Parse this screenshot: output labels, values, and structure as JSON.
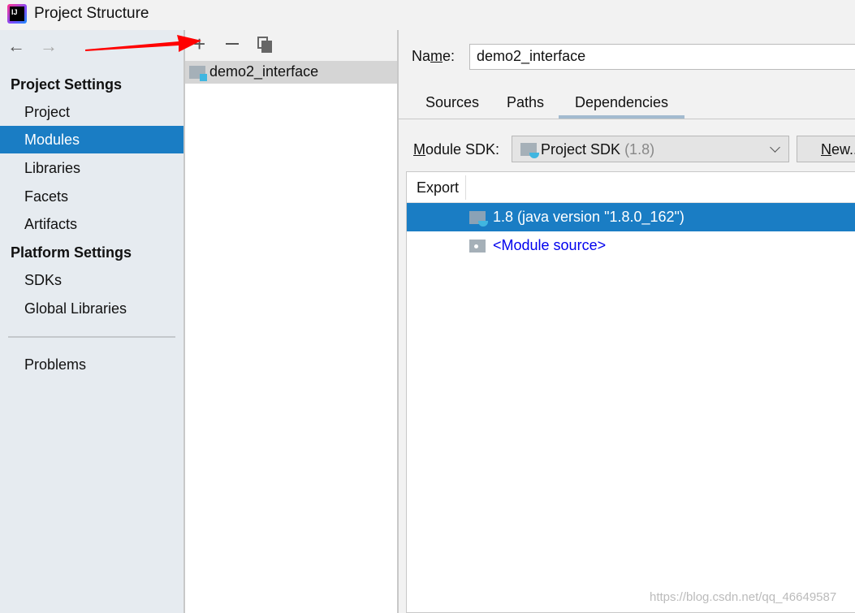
{
  "window": {
    "title": "Project Structure",
    "icon": "intellij-idea-icon"
  },
  "sidebar": {
    "sections": [
      {
        "label": "Project Settings",
        "items": [
          "Project",
          "Modules",
          "Libraries",
          "Facets",
          "Artifacts"
        ]
      },
      {
        "label": "Platform Settings",
        "items": [
          "SDKs",
          "Global Libraries"
        ]
      }
    ],
    "problems": "Problems",
    "selected": "Modules"
  },
  "toolbar": {
    "back": "back-arrow-icon",
    "forward": "forward-arrow-icon",
    "add": "plus-icon",
    "remove": "minus-icon",
    "copy": "copy-icon"
  },
  "modules": [
    {
      "name": "demo2_interface",
      "selected": true
    }
  ],
  "details": {
    "name_label_pre": "Na",
    "name_label_u": "m",
    "name_label_post": "e:",
    "name_value": "demo2_interface",
    "tabs": [
      "Sources",
      "Paths",
      "Dependencies"
    ],
    "active_tab": "Dependencies",
    "sdk_label_u": "M",
    "sdk_label_rest": "odule SDK:",
    "sdk_value": "Project SDK",
    "sdk_version": "(1.8)",
    "new_u": "N",
    "new_rest": "ew...",
    "table": {
      "header": "Export",
      "rows": [
        {
          "text": "1.8 (java version \"1.8.0_162\")",
          "selected": true
        },
        {
          "text": "<Module source>",
          "selected": false
        }
      ]
    }
  },
  "colors": {
    "selection": "#1a7dc4",
    "link": "#0000ee",
    "annotation_arrow": "#ff0000"
  },
  "watermark": "https://blog.csdn.net/qq_46649587"
}
